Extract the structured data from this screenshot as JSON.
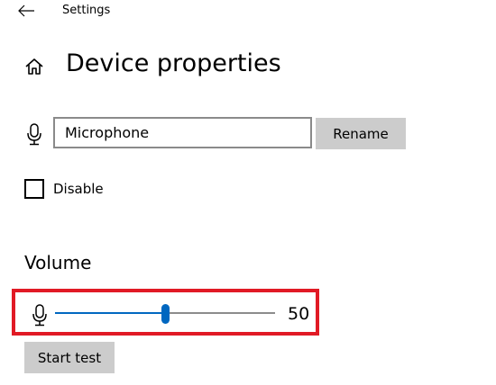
{
  "titlebar": {
    "title": "Settings",
    "back_icon": "back-arrow-icon"
  },
  "header": {
    "title": "Device properties",
    "icon": "home-icon"
  },
  "device": {
    "icon": "microphone-icon",
    "name_value": "Microphone",
    "rename_label": "Rename"
  },
  "disable": {
    "label": "Disable",
    "checked": false
  },
  "volume": {
    "heading": "Volume",
    "icon": "microphone-icon",
    "level": 50,
    "max": 100,
    "value_text": "50",
    "accent_color": "#0067c0",
    "highlight_color": "#e11a25"
  },
  "test": {
    "start_label": "Start test"
  }
}
